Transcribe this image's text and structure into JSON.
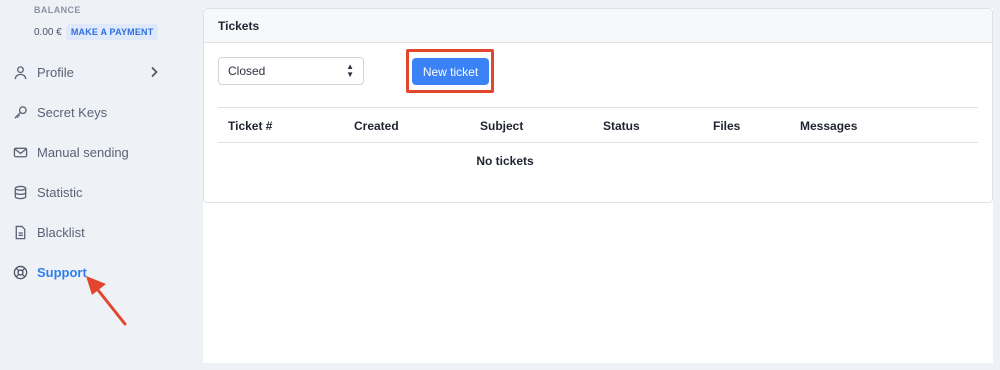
{
  "sidebar": {
    "balance_label": "BALANCE",
    "balance_amount": "0.00 €",
    "pay_button": "MAKE A PAYMENT",
    "items": [
      {
        "label": "Profile",
        "icon": "user-icon",
        "has_chevron": true
      },
      {
        "label": "Secret Keys",
        "icon": "key-icon"
      },
      {
        "label": "Manual sending",
        "icon": "envelope-icon"
      },
      {
        "label": "Statistic",
        "icon": "database-icon"
      },
      {
        "label": "Blacklist",
        "icon": "document-icon"
      },
      {
        "label": "Support",
        "icon": "lifebuoy-icon",
        "active": true
      }
    ]
  },
  "tickets": {
    "title": "Tickets",
    "filter_value": "Closed",
    "new_ticket_label": "New ticket",
    "columns": [
      "Ticket #",
      "Created",
      "Subject",
      "Status",
      "Files",
      "Messages"
    ],
    "empty_message": "No tickets"
  },
  "colors": {
    "accent": "#3b82f6",
    "active_nav": "#2f80ed",
    "annotation": "#e2462c"
  }
}
